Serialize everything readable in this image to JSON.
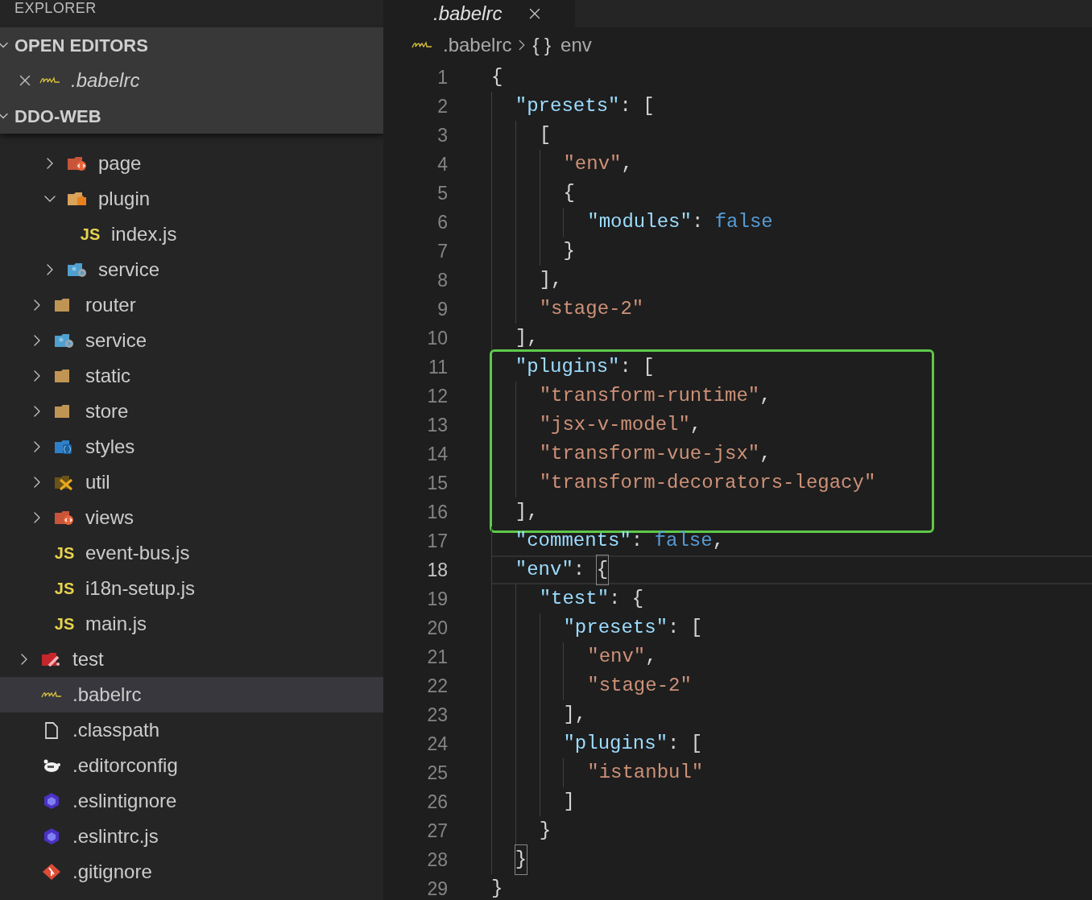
{
  "sidebar": {
    "title": "EXPLORER",
    "open_editors": {
      "title": "OPEN EDITORS",
      "expanded": true,
      "items": [
        {
          "name": ".babelrc",
          "kind": "babel",
          "preview": true
        }
      ]
    },
    "project": {
      "title": "DDO-WEB",
      "expanded": true,
      "tree": [
        {
          "children": [
            {
              "children": [
                {
                  "name": "page",
                  "kind": "folder-html",
                  "expanded": false,
                  "selected": false
                },
                {
                  "name": "plugin",
                  "kind": "folder-plugin",
                  "expanded": true,
                  "selected": false,
                  "children": [
                    {
                      "name": "index.js",
                      "kind": "js",
                      "icon_text": "JS",
                      "selected": false
                    }
                  ]
                },
                {
                  "name": "service",
                  "kind": "folder-service",
                  "expanded": false,
                  "selected": false
                }
              ]
            },
            {
              "name": "router",
              "kind": "folder",
              "expanded": false,
              "selected": false
            },
            {
              "name": "service",
              "kind": "folder-service",
              "expanded": false,
              "selected": false
            },
            {
              "name": "static",
              "kind": "folder",
              "expanded": false,
              "selected": false
            },
            {
              "name": "store",
              "kind": "folder",
              "expanded": false,
              "selected": false
            },
            {
              "name": "styles",
              "kind": "folder-styles",
              "expanded": false,
              "selected": false
            },
            {
              "name": "util",
              "kind": "folder-tools",
              "expanded": false,
              "selected": false
            },
            {
              "name": "views",
              "kind": "folder-html",
              "expanded": false,
              "selected": false
            },
            {
              "name": "event-bus.js",
              "kind": "js",
              "icon_text": "JS",
              "selected": false
            },
            {
              "name": "i18n-setup.js",
              "kind": "js",
              "icon_text": "JS",
              "selected": false
            },
            {
              "name": "main.js",
              "kind": "js",
              "icon_text": "JS",
              "selected": false
            }
          ]
        },
        {
          "name": "test",
          "kind": "folder-test",
          "expanded": false,
          "selected": false
        },
        {
          "name": ".babelrc",
          "kind": "babel",
          "selected": true
        },
        {
          "name": ".classpath",
          "kind": "file",
          "selected": false
        },
        {
          "name": ".editorconfig",
          "kind": "editorconfig",
          "selected": false
        },
        {
          "name": ".eslintignore",
          "kind": "eslint",
          "selected": false
        },
        {
          "name": ".eslintrc.js",
          "kind": "eslint",
          "selected": false
        },
        {
          "name": ".gitignore",
          "kind": "git",
          "selected": false
        }
      ]
    }
  },
  "editor": {
    "tab": {
      "label": ".babelrc",
      "preview": true
    },
    "breadcrumb": [
      {
        "kind": "babel",
        "text": ".babelrc"
      },
      {
        "kind": "symbol",
        "icon": "{ }",
        "text": "env"
      }
    ],
    "blocks": [
      {
        "boxed": false,
        "lines": [
          {
            "number": "1",
            "current": false,
            "tokens": [
              {
                "kind": "punct",
                "text": "{"
              }
            ]
          },
          {
            "number": "2",
            "current": false,
            "tokens": [
              {
                "kind": "key",
                "text": "  \"presets\""
              },
              {
                "kind": "punct",
                "text": ": ["
              }
            ]
          },
          {
            "number": "3",
            "current": false,
            "tokens": [
              {
                "kind": "punct",
                "text": "    ["
              }
            ]
          },
          {
            "number": "4",
            "current": false,
            "tokens": [
              {
                "kind": "string",
                "text": "      \"env\""
              },
              {
                "kind": "punct",
                "text": ","
              }
            ]
          },
          {
            "number": "5",
            "current": false,
            "tokens": [
              {
                "kind": "punct",
                "text": "      {"
              }
            ]
          },
          {
            "number": "6",
            "current": false,
            "tokens": [
              {
                "kind": "key",
                "text": "        \"modules\""
              },
              {
                "kind": "punct",
                "text": ": "
              },
              {
                "kind": "keyword",
                "text": "false"
              }
            ]
          },
          {
            "number": "7",
            "current": false,
            "tokens": [
              {
                "kind": "punct",
                "text": "      }"
              }
            ]
          },
          {
            "number": "8",
            "current": false,
            "tokens": [
              {
                "kind": "punct",
                "text": "    ],"
              }
            ]
          },
          {
            "number": "9",
            "current": false,
            "tokens": [
              {
                "kind": "string",
                "text": "    \"stage-2\""
              }
            ]
          },
          {
            "number": "10",
            "current": false,
            "tokens": [
              {
                "kind": "punct",
                "text": "  ],"
              }
            ]
          }
        ]
      },
      {
        "boxed": true,
        "lines": [
          {
            "number": "11",
            "current": false,
            "tokens": [
              {
                "kind": "key",
                "text": "  \"plugins\""
              },
              {
                "kind": "punct",
                "text": ": ["
              }
            ]
          },
          {
            "number": "12",
            "current": false,
            "tokens": [
              {
                "kind": "string",
                "text": "    \"transform-runtime\""
              },
              {
                "kind": "punct",
                "text": ","
              }
            ]
          },
          {
            "number": "13",
            "current": false,
            "tokens": [
              {
                "kind": "string",
                "text": "    \"jsx-v-model\""
              },
              {
                "kind": "punct",
                "text": ","
              }
            ]
          },
          {
            "number": "14",
            "current": false,
            "tokens": [
              {
                "kind": "string",
                "text": "    \"transform-vue-jsx\""
              },
              {
                "kind": "punct",
                "text": ","
              }
            ]
          },
          {
            "number": "15",
            "current": false,
            "tokens": [
              {
                "kind": "string",
                "text": "    \"transform-decorators-legacy\""
              }
            ]
          },
          {
            "number": "16",
            "current": false,
            "tokens": [
              {
                "kind": "punct",
                "text": "  ],"
              }
            ]
          }
        ]
      },
      {
        "boxed": false,
        "lines": [
          {
            "number": "17",
            "current": false,
            "tokens": [
              {
                "kind": "key",
                "text": "  \"comments\""
              },
              {
                "kind": "punct",
                "text": ": "
              },
              {
                "kind": "keyword",
                "text": "false"
              },
              {
                "kind": "punct",
                "text": ","
              }
            ]
          },
          {
            "number": "18",
            "current": true,
            "tokens": [
              {
                "kind": "key",
                "text": "  \"env\""
              },
              {
                "kind": "punct",
                "text": ": "
              },
              {
                "kind": "bracket_match",
                "text": "{"
              }
            ]
          },
          {
            "number": "19",
            "current": false,
            "tokens": [
              {
                "kind": "key",
                "text": "    \"test\""
              },
              {
                "kind": "punct",
                "text": ": {"
              }
            ]
          },
          {
            "number": "20",
            "current": false,
            "tokens": [
              {
                "kind": "key",
                "text": "      \"presets\""
              },
              {
                "kind": "punct",
                "text": ": ["
              }
            ]
          },
          {
            "number": "21",
            "current": false,
            "tokens": [
              {
                "kind": "string",
                "text": "        \"env\""
              },
              {
                "kind": "punct",
                "text": ","
              }
            ]
          },
          {
            "number": "22",
            "current": false,
            "tokens": [
              {
                "kind": "string",
                "text": "        \"stage-2\""
              }
            ]
          },
          {
            "number": "23",
            "current": false,
            "tokens": [
              {
                "kind": "punct",
                "text": "      ],"
              }
            ]
          },
          {
            "number": "24",
            "current": false,
            "tokens": [
              {
                "kind": "key",
                "text": "      \"plugins\""
              },
              {
                "kind": "punct",
                "text": ": ["
              }
            ]
          },
          {
            "number": "25",
            "current": false,
            "tokens": [
              {
                "kind": "string",
                "text": "        \"istanbul\""
              }
            ]
          },
          {
            "number": "26",
            "current": false,
            "tokens": [
              {
                "kind": "punct",
                "text": "      ]"
              }
            ]
          },
          {
            "number": "27",
            "current": false,
            "tokens": [
              {
                "kind": "punct",
                "text": "    }"
              }
            ]
          },
          {
            "number": "28",
            "current": false,
            "tokens": [
              {
                "kind": "bracket_match",
                "text": "  }"
              }
            ]
          },
          {
            "number": "29",
            "current": false,
            "tokens": [
              {
                "kind": "punct",
                "text": "}"
              }
            ]
          }
        ]
      }
    ]
  }
}
